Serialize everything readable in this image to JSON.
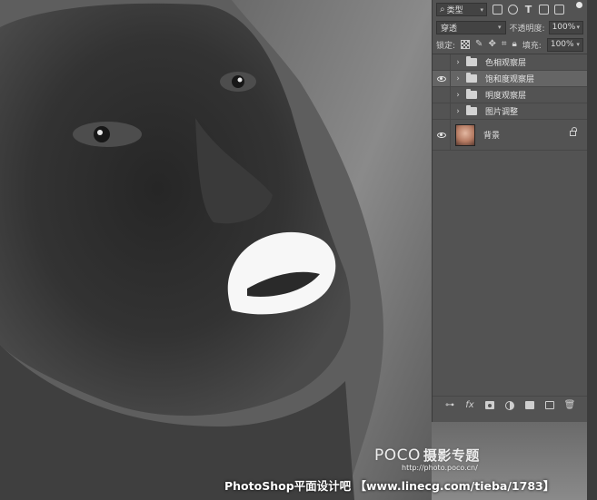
{
  "layers_panel": {
    "filter": {
      "label": "类型"
    },
    "blend_mode": "穿透",
    "opacity": {
      "label": "不透明度:",
      "value": "100%"
    },
    "lock": {
      "label": "锁定:"
    },
    "fill": {
      "label": "填充:",
      "value": "100%"
    },
    "layers": [
      {
        "name": "色相观察层",
        "type": "group",
        "visible": false,
        "selected": false
      },
      {
        "name": "饱和度观察层",
        "type": "group",
        "visible": true,
        "selected": true
      },
      {
        "name": "明度观察层",
        "type": "group",
        "visible": false,
        "selected": false
      },
      {
        "name": "图片调整",
        "type": "group",
        "visible": false,
        "selected": false
      },
      {
        "name": "背景",
        "type": "background",
        "visible": true,
        "selected": false,
        "locked": true
      }
    ],
    "bottom_icons": [
      "link-icon",
      "fx-icon",
      "mask-icon",
      "adjustment-icon",
      "folder-icon",
      "new-layer-icon",
      "trash-icon"
    ],
    "fx_label": "fx"
  },
  "watermark": {
    "brand": "POCO",
    "brand_cn": "摄影专题",
    "url": "http://photo.poco.cn/",
    "footer": "PhotoShop平面设计吧 【www.linecg.com/tieba/1783】"
  }
}
